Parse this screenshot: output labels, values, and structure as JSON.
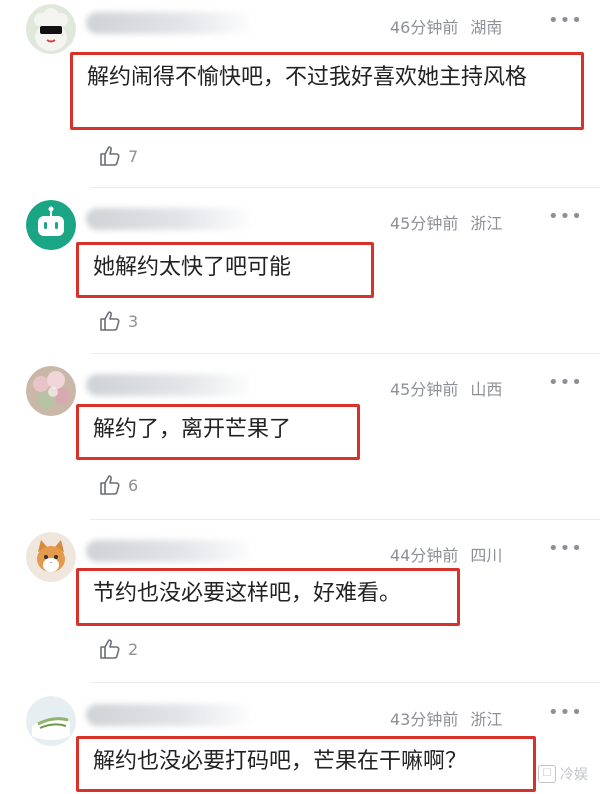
{
  "comments": [
    {
      "time": "46分钟前",
      "location": "湖南",
      "text": "解约闹得不愉快吧，不过我好喜欢她主持风格",
      "likes": "7",
      "avatar": "sheep-avatar"
    },
    {
      "time": "45分钟前",
      "location": "浙江",
      "text": "她解约太快了吧可能",
      "likes": "3",
      "avatar": "robot-avatar"
    },
    {
      "time": "45分钟前",
      "location": "山西",
      "text": "解约了，离开芒果了",
      "likes": "6",
      "avatar": "flower-avatar"
    },
    {
      "time": "44分钟前",
      "location": "四川",
      "text": "节约也没必要这样吧，好难看。",
      "likes": "2",
      "avatar": "cat-avatar"
    },
    {
      "time": "43分钟前",
      "location": "浙江",
      "text": "解约也没必要打码吧，芒果在干嘛啊？",
      "likes": "",
      "avatar": "plant-avatar"
    }
  ],
  "ui": {
    "more_glyph": "•••"
  },
  "watermark": {
    "text": "冷娱"
  },
  "colors": {
    "highlight_border": "#d9322b",
    "meta_gray": "#8d9097"
  }
}
